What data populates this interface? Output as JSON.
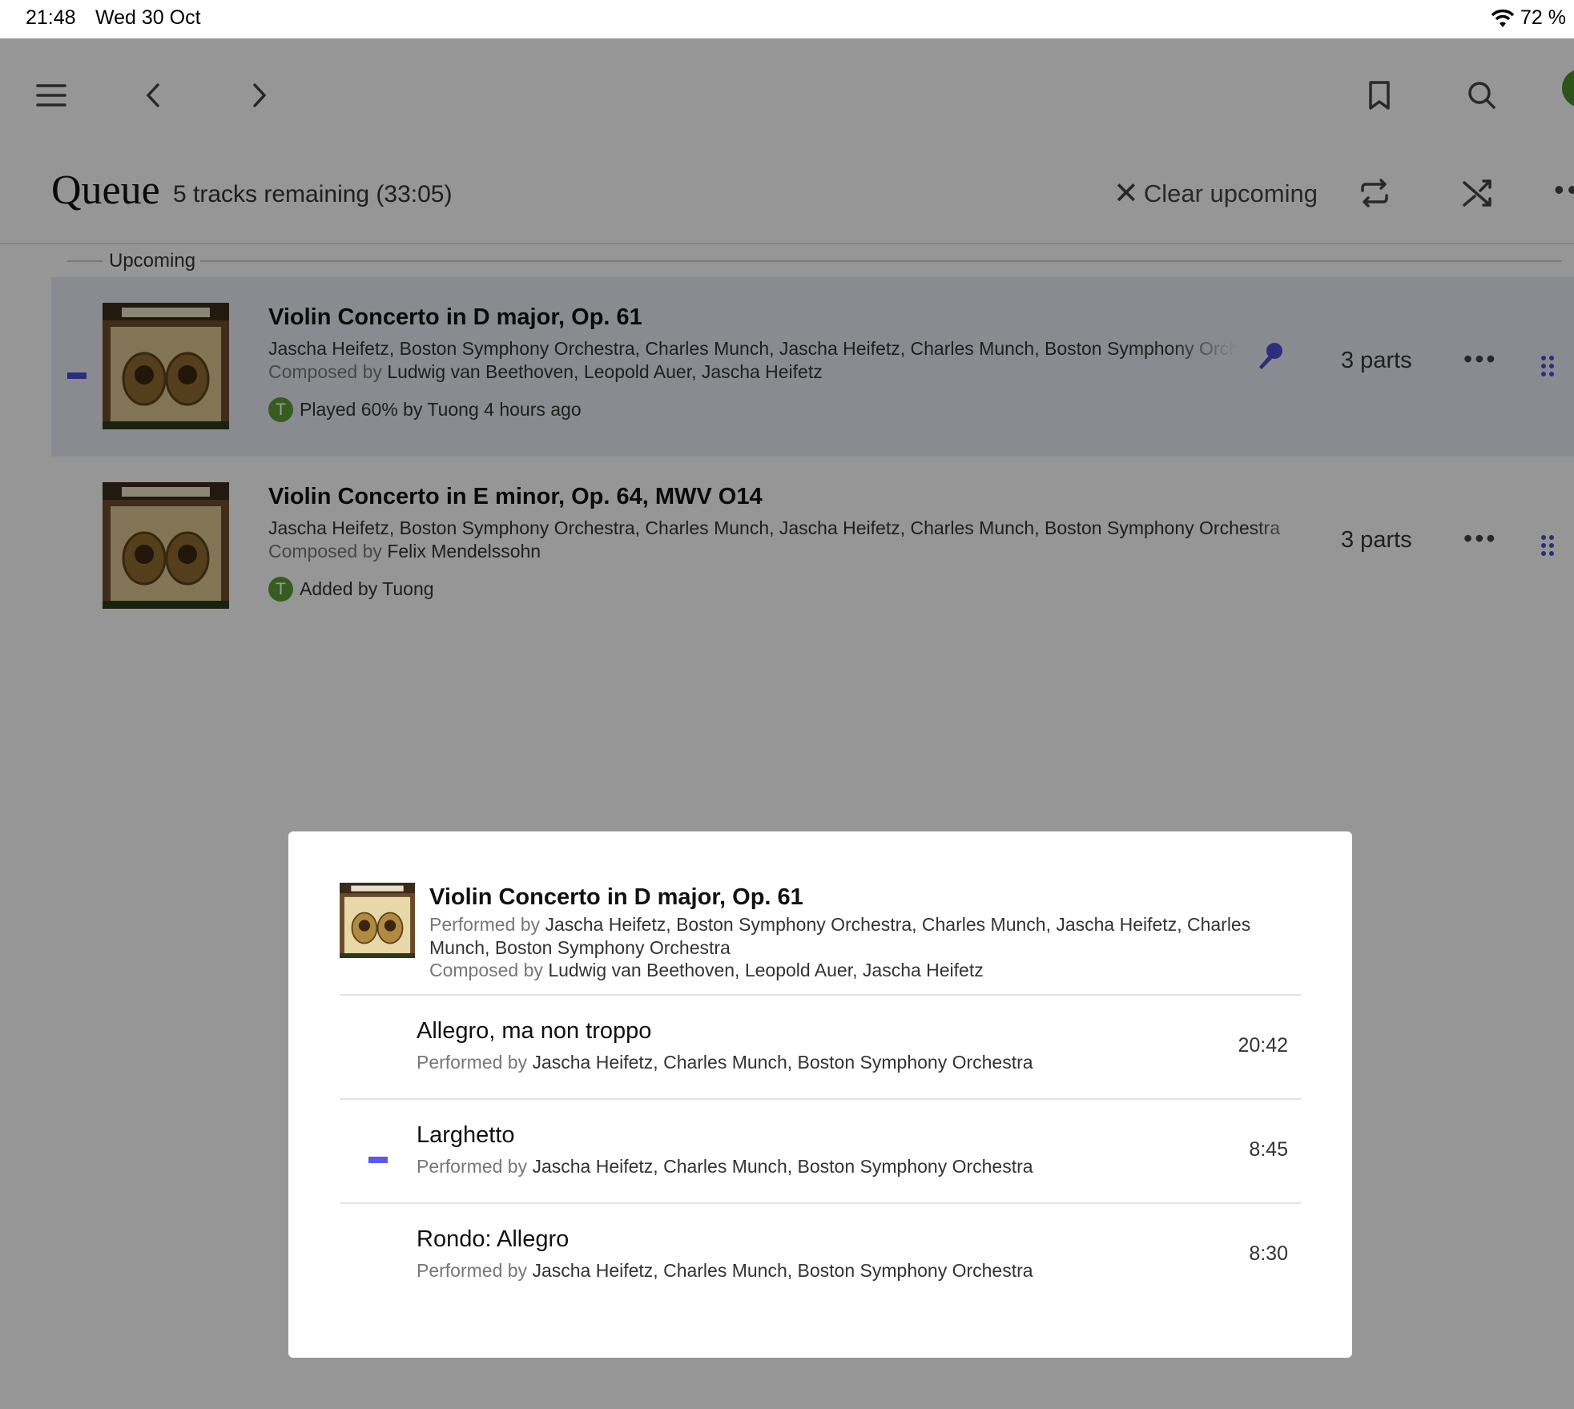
{
  "status_bar": {
    "time": "21:48",
    "date": "Wed 30 Oct",
    "battery": "72 %"
  },
  "nav": {
    "icons": [
      "menu-icon",
      "back-icon",
      "forward-icon",
      "bookmark-icon",
      "search-icon"
    ]
  },
  "queue": {
    "title": "Queue",
    "subtitle": "5 tracks remaining (33:05)",
    "clear_label": "Clear upcoming",
    "section_label": "Upcoming"
  },
  "tracks": [
    {
      "title": "Violin Concerto in D major, Op. 61",
      "performers": "Jascha Heifetz, Boston Symphony Orchestra, Charles Munch, Jascha Heifetz, Charles Munch, Boston Symphony Orchestra",
      "composed_prefix": "Composed by",
      "composers": "Ludwig van Beethoven, Leopold Auer, Jascha Heifetz",
      "avatar_initial": "T",
      "history": "Played 60% by Tuong 4 hours ago",
      "parts": "3 parts",
      "active": true
    },
    {
      "title": "Violin Concerto in E minor, Op. 64, MWV O14",
      "performers": "Jascha Heifetz, Boston Symphony Orchestra, Charles Munch, Jascha Heifetz, Charles Munch, Boston Symphony Orchestra",
      "composed_prefix": "Composed by",
      "composers": "Felix Mendelssohn",
      "avatar_initial": "T",
      "history": "Added by Tuong",
      "parts": "3 parts",
      "active": false
    }
  ],
  "modal": {
    "title": "Violin Concerto in D major, Op. 61",
    "performed_prefix": "Performed by",
    "performers": "Jascha Heifetz, Boston Symphony Orchestra, Charles Munch, Jascha Heifetz, Charles Munch, Boston Symphony Orchestra",
    "composed_prefix": "Composed by",
    "composers": "Ludwig van Beethoven, Leopold Auer, Jascha Heifetz",
    "parts": [
      {
        "title": "Allegro, ma non troppo",
        "performed_prefix": "Performed by",
        "performers": "Jascha Heifetz, Charles Munch, Boston Symphony Orchestra",
        "duration": "20:42",
        "playing": false
      },
      {
        "title": "Larghetto",
        "performed_prefix": "Performed by",
        "performers": "Jascha Heifetz, Charles Munch, Boston Symphony Orchestra",
        "duration": "8:45",
        "playing": true
      },
      {
        "title": "Rondo: Allegro",
        "performed_prefix": "Performed by",
        "performers": "Jascha Heifetz, Charles Munch, Boston Symphony Orchestra",
        "duration": "8:30",
        "playing": false
      }
    ]
  },
  "colors": {
    "accent": "#4b4bd0",
    "avatar": "#5a9a36",
    "overlay": "rgba(0,0,0,0.40)"
  }
}
